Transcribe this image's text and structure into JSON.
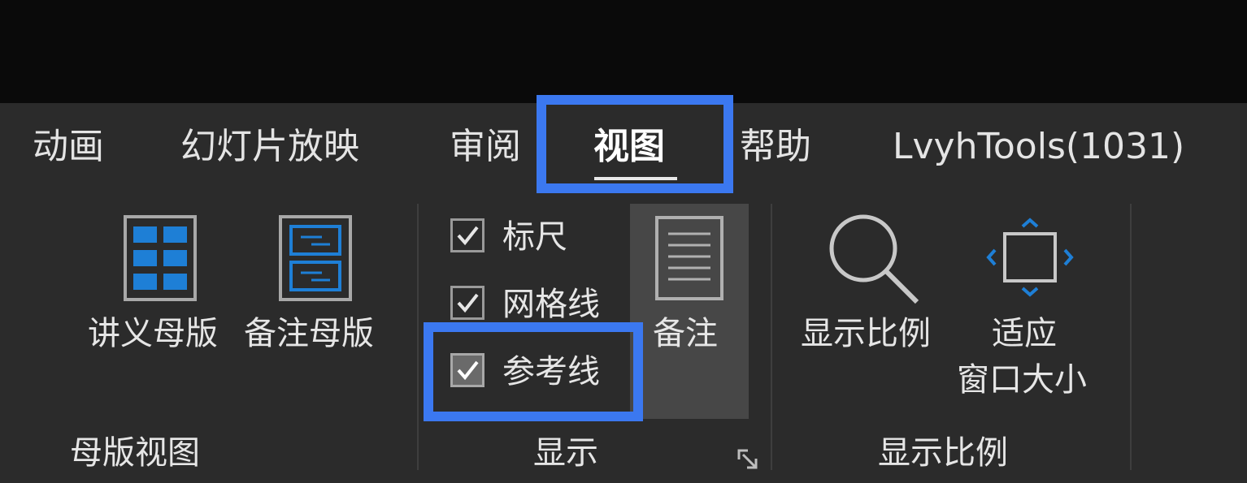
{
  "tabs": [
    {
      "label": "动画"
    },
    {
      "label": "幻灯片放映"
    },
    {
      "label": "审阅"
    },
    {
      "label": "视图",
      "active": true
    },
    {
      "label": "帮助"
    },
    {
      "label": "LvyhTools(1031)"
    }
  ],
  "groups": {
    "master_views": {
      "label": "母版视图",
      "handout_master_label": "讲义母版",
      "notes_master_label": "备注母版"
    },
    "show": {
      "label": "显示",
      "ruler": {
        "label": "标尺",
        "checked": true
      },
      "gridlines": {
        "label": "网格线",
        "checked": true
      },
      "guides": {
        "label": "参考线",
        "checked": true
      },
      "notes_label": "备注"
    },
    "zoom": {
      "label": "显示比例",
      "zoom_label": "显示比例",
      "fit_window_line1": "适应",
      "fit_window_line2": "窗口大小"
    }
  },
  "colors": {
    "highlight": "#3b78f0",
    "icon_blue": "#1e7fd6",
    "ribbon_bg": "#2b2b2b",
    "titlebar_bg": "#0a0a0a"
  },
  "icons": [
    "handout-master-icon",
    "notes-master-icon",
    "checkmark-icon",
    "notes-page-icon",
    "magnifier-icon",
    "fit-window-icon",
    "dialog-launcher-icon"
  ]
}
